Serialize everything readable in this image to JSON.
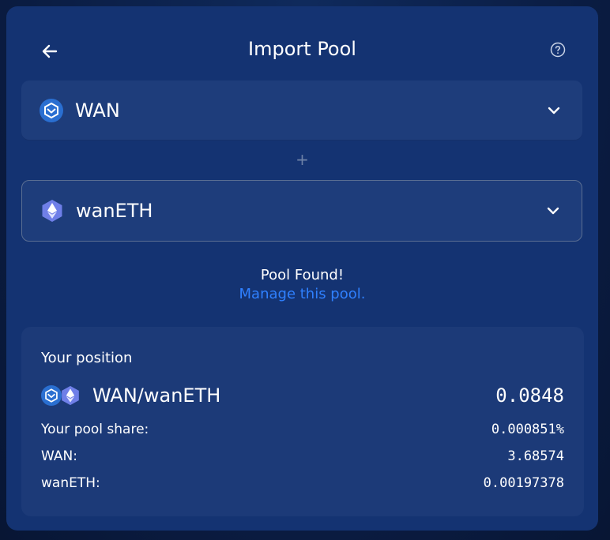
{
  "header": {
    "title": "Import Pool"
  },
  "selectors": [
    {
      "token": "WAN",
      "icon": "wan-token-icon",
      "color": "#2a6fd1"
    },
    {
      "token": "wanETH",
      "icon": "eth-token-icon",
      "color": "#6f7fe8"
    }
  ],
  "plus_symbol": "+",
  "status": {
    "found": "Pool Found!",
    "manage_link": "Manage this pool."
  },
  "position": {
    "title": "Your position",
    "pair": "WAN/wanETH",
    "pair_value": "0.0848",
    "rows": [
      {
        "label": "Your pool share:",
        "value": "0.000851%"
      },
      {
        "label": "WAN:",
        "value": "3.68574"
      },
      {
        "label": "wanETH:",
        "value": "0.00197378"
      }
    ]
  },
  "colors": {
    "background": "#0a1d44",
    "card": "#143372",
    "panel": "#1e3d7b",
    "link": "#2f80ff"
  }
}
